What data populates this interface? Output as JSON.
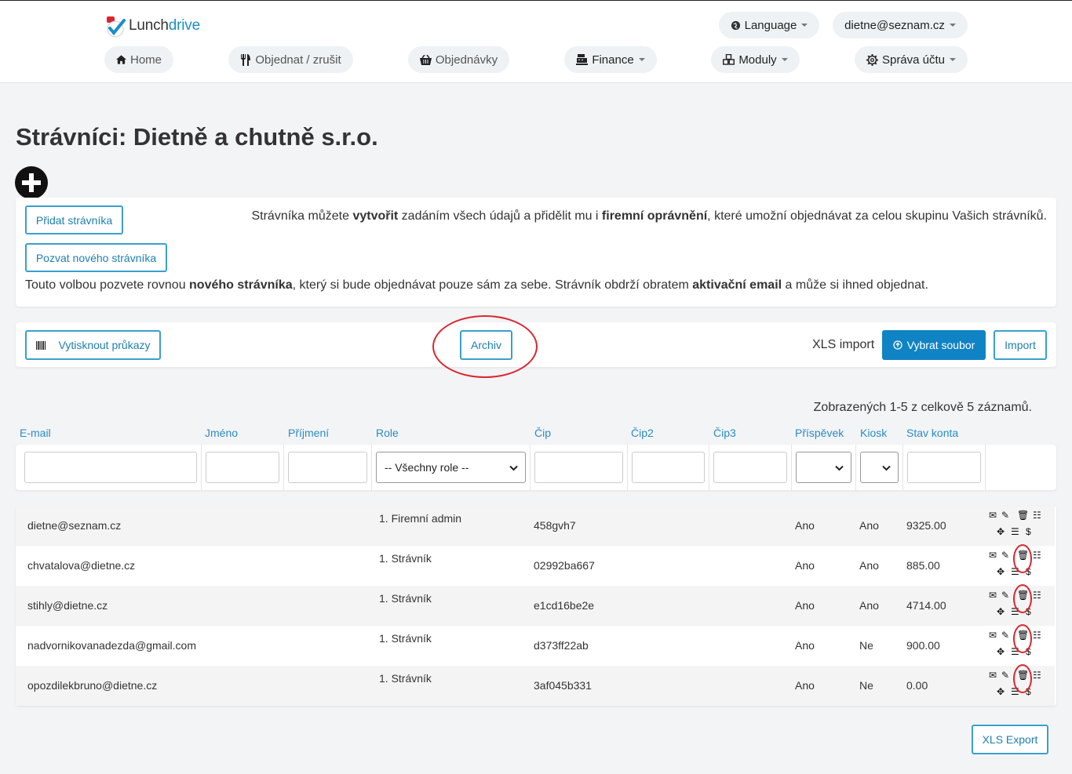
{
  "app": {
    "logo_text_a": "Lunch",
    "logo_text_b": "drive"
  },
  "header": {
    "language": "Language",
    "user": "dietne@seznam.cz",
    "nav": [
      {
        "label": "Home",
        "icon": "home-icon"
      },
      {
        "label": "Objednat / zrušit",
        "icon": "cutlery-icon"
      },
      {
        "label": "Objednávky",
        "icon": "basket-icon"
      },
      {
        "label": "Finance",
        "icon": "cash-register-icon"
      },
      {
        "label": "Moduly",
        "icon": "cubes-icon"
      },
      {
        "label": "Správa účtu",
        "icon": "gear-icon"
      }
    ]
  },
  "page": {
    "title": "Strávníci: Dietně a chutně s.r.o."
  },
  "info": {
    "add_button": "Přidat strávníka",
    "invite_button": "Pozvat nového strávníka",
    "create_text": {
      "a": "Strávníka můžete ",
      "b": "vytvořit",
      "c": " zadáním všech údajů a přidělit mu i ",
      "d": "firemní oprávnění",
      "e": ", které umožní objednávat za celou skupinu Vašich strávníků."
    },
    "invite_text": {
      "a": "Touto volbou pozvete rovnou ",
      "b": "nového strávníka",
      "c": ", který si bude objednávat pouze sám za sebe. Strávník obdrží obratem ",
      "d": "aktivační email",
      "e": " a může si ihned objednat."
    }
  },
  "toolbar": {
    "print_cards": "Vytisknout průkazy",
    "archive": "Archiv",
    "xls_import_label": "XLS import",
    "choose_file": "Vybrat soubor",
    "import": "Import"
  },
  "table": {
    "summary": "Zobrazených 1-5 z celkově 5 záznamů.",
    "columns": [
      "E-mail",
      "Jméno",
      "Příjmení",
      "Role",
      "Čip",
      "Čip2",
      "Čip3",
      "Příspěvek",
      "Kiosk",
      "Stav konta"
    ],
    "role_filter": "-- Všechny role --",
    "rows": [
      {
        "email": "dietne@seznam.cz",
        "jmeno": "",
        "prijmeni": "",
        "role": "1. Firemní admin",
        "cip": "458gvh7",
        "cip2": "",
        "cip3": "",
        "prispevek": "Ano",
        "kiosk": "Ano",
        "stav": "9325.00"
      },
      {
        "email": "chvatalova@dietne.cz",
        "jmeno": "",
        "prijmeni": "",
        "role": "1. Strávník",
        "cip": "02992ba667",
        "cip2": "",
        "cip3": "",
        "prispevek": "Ano",
        "kiosk": "Ano",
        "stav": "885.00"
      },
      {
        "email": "stihly@dietne.cz",
        "jmeno": "",
        "prijmeni": "",
        "role": "1. Strávník",
        "cip": "e1cd16be2e",
        "cip2": "",
        "cip3": "",
        "prispevek": "Ano",
        "kiosk": "Ano",
        "stav": "4714.00"
      },
      {
        "email": "nadvornikovanadezda@gmail.com",
        "jmeno": "",
        "prijmeni": "",
        "role": "1. Strávník",
        "cip": "d373ff22ab",
        "cip2": "",
        "cip3": "",
        "prispevek": "Ano",
        "kiosk": "Ne",
        "stav": "900.00"
      },
      {
        "email": "opozdilekbruno@dietne.cz",
        "jmeno": "",
        "prijmeni": "",
        "role": "1. Strávník",
        "cip": "3af045b331",
        "cip2": "",
        "cip3": "",
        "prispevek": "Ano",
        "kiosk": "Ne",
        "stav": "0.00"
      }
    ],
    "action_icons": [
      "envelope-icon",
      "pencil-icon",
      "trash-icon",
      "list-icon",
      "move-icon",
      "lines-icon",
      "dollar-icon"
    ]
  },
  "footer": {
    "xls_export": "XLS Export"
  },
  "colors": {
    "accent": "#1083c4",
    "link": "#2b8cc4",
    "highlight": "#d9262e"
  }
}
